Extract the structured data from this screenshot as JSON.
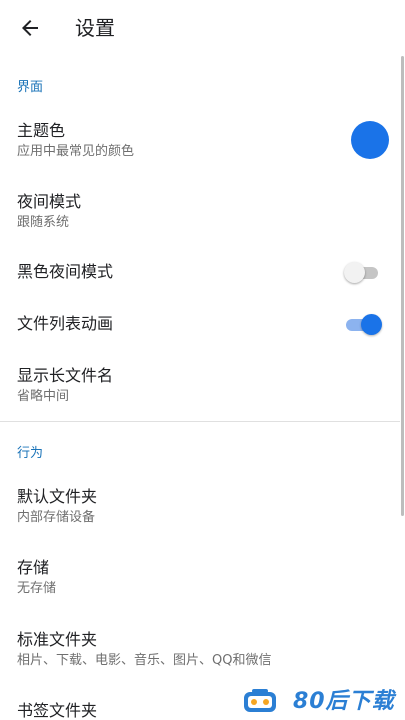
{
  "header": {
    "title": "设置",
    "back_icon": "arrow-left-icon"
  },
  "colors": {
    "accent": "#1a73e8",
    "section_header": "#1a73b8"
  },
  "sections": [
    {
      "header": "界面",
      "items": [
        {
          "title": "主题色",
          "summary": "应用中最常见的颜色",
          "widget": "color-swatch",
          "swatch_color": "#1a73e8"
        },
        {
          "title": "夜间模式",
          "summary": "跟随系统"
        },
        {
          "title": "黑色夜间模式",
          "widget": "switch",
          "checked": false
        },
        {
          "title": "文件列表动画",
          "widget": "switch",
          "checked": true
        },
        {
          "title": "显示长文件名",
          "summary": "省略中间"
        }
      ]
    },
    {
      "header": "行为",
      "items": [
        {
          "title": "默认文件夹",
          "summary": "内部存储设备"
        },
        {
          "title": "存储",
          "summary": "无存储"
        },
        {
          "title": "标准文件夹",
          "summary": "相片、下载、电影、音乐、图片、QQ和微信"
        },
        {
          "title": "书签文件夹"
        }
      ]
    }
  ],
  "watermark": {
    "text": "80后下载",
    "logo_icon": "game-controller-logo"
  }
}
